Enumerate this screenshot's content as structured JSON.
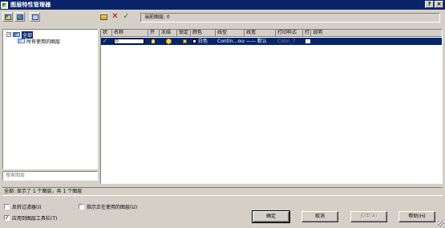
{
  "window": {
    "title": "图层特性管理器",
    "help_label": "?",
    "close_label": "×"
  },
  "toolbar_right": {
    "current_layer_text": "当前图层: 0"
  },
  "tree": {
    "root_label": "全部",
    "root_expander": "−",
    "child_label": "所有使用的图层"
  },
  "search": {
    "placeholder": "搜索图层"
  },
  "list": {
    "headers": [
      "状",
      "名称",
      "开",
      "冻结",
      "锁定",
      "颜色",
      "线型",
      "线宽",
      "打印样式",
      "打",
      "说明"
    ],
    "rows": [
      {
        "status_glyph": "✓",
        "name": "0",
        "color": "白色",
        "linetype": "Contin…ous",
        "lineweight": "—— 默认",
        "plot_style": "Color_7"
      }
    ]
  },
  "status_bar": {
    "text": "全部: 显示了 1 个图层，共 1 个图层"
  },
  "options": {
    "invert_filter": "反转过滤器(I)",
    "invert_filter_checked": false,
    "indicate_in_use": "指示正在使用的图层(U)",
    "indicate_in_use_checked": false,
    "apply_to_toolbar": "应用到图层工具栏(T)",
    "apply_to_toolbar_checked": true
  },
  "buttons": {
    "ok": "确定",
    "cancel": "取消",
    "apply": "应用(A)",
    "help": "帮助(H)"
  },
  "colors": {
    "titlebar": "#0a246a",
    "selection": "#0a246a",
    "face": "#d4d0c8"
  }
}
